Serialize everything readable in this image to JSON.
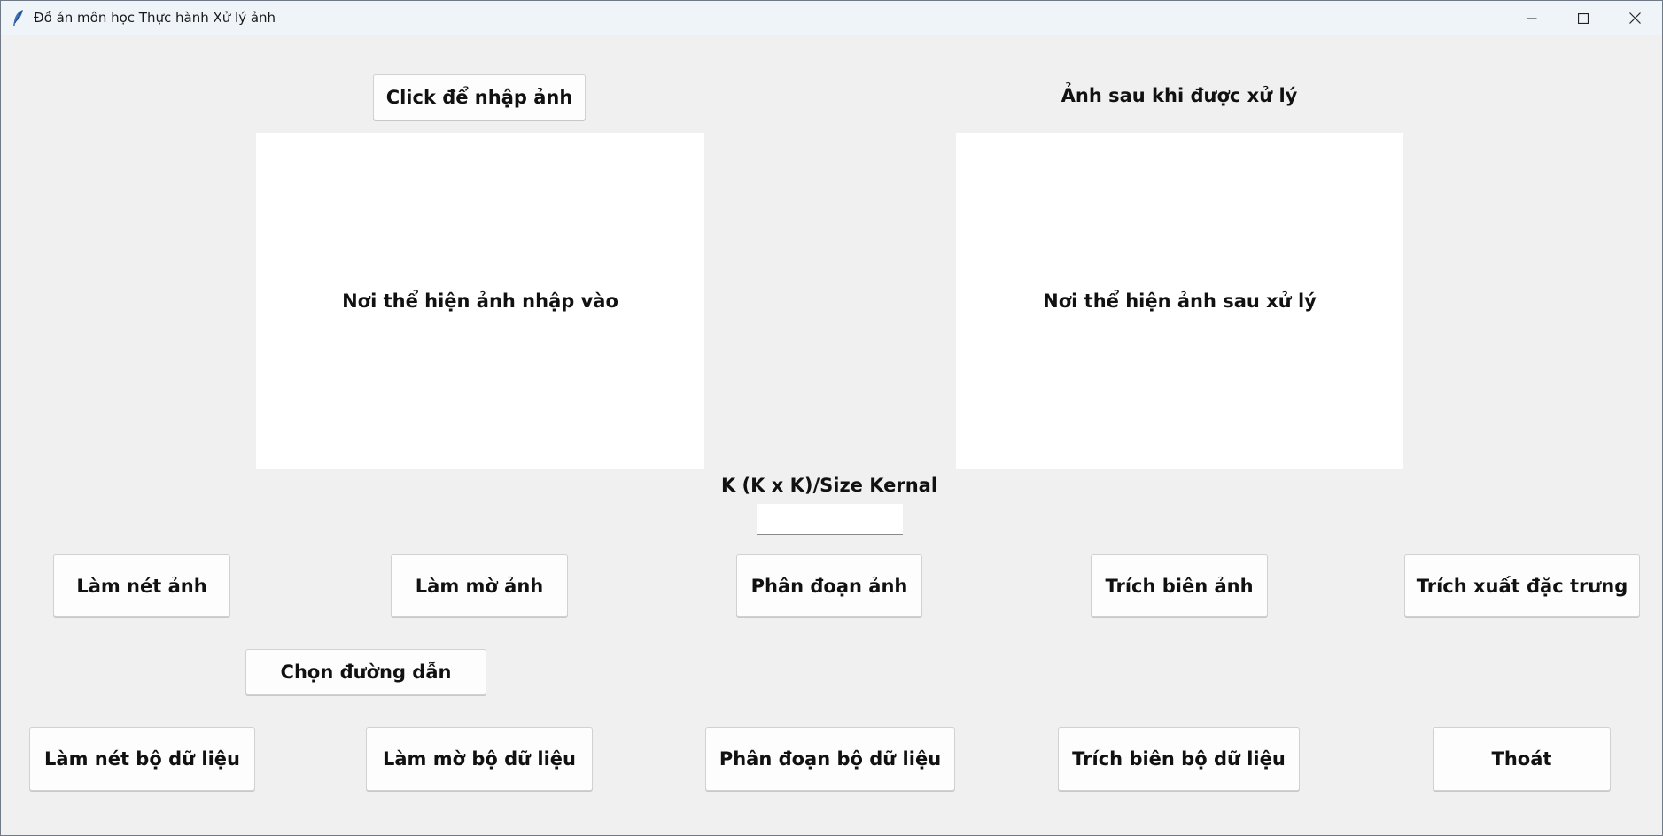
{
  "window": {
    "title": "Đồ án môn học Thực hành Xử lý ảnh",
    "icon": "feather-icon",
    "controls": [
      "minimize-icon",
      "maximize-icon",
      "close-icon"
    ]
  },
  "input_section": {
    "import_button_label": "Click để nhập ảnh",
    "panel_text": "Nơi thể hiện ảnh nhập vào"
  },
  "output_section": {
    "heading": "Ảnh sau khi được xử lý",
    "panel_text": "Nơi thể hiện ảnh sau xử lý"
  },
  "kernel": {
    "label": "K (K x K)/Size Kernal",
    "value": "",
    "placeholder": ""
  },
  "image_actions": [
    {
      "label": "Làm nét ảnh"
    },
    {
      "label": "Làm mờ ảnh"
    },
    {
      "label": "Phân đoạn ảnh"
    },
    {
      "label": "Trích biên ảnh"
    },
    {
      "label": "Trích xuất đặc trưng"
    }
  ],
  "path_button_label": "Chọn đường dẫn",
  "dataset_actions": [
    {
      "label": "Làm nét bộ dữ liệu"
    },
    {
      "label": "Làm mờ bộ dữ liệu"
    },
    {
      "label": "Phân đoạn bộ dữ liệu"
    },
    {
      "label": "Trích biên bộ dữ liệu"
    },
    {
      "label": "Thoát"
    }
  ],
  "colors": {
    "background": "#f0f0f0",
    "titlebar": "#eff4f9",
    "panel": "#ffffff",
    "button": "#fdfdfd",
    "text": "#111111"
  }
}
